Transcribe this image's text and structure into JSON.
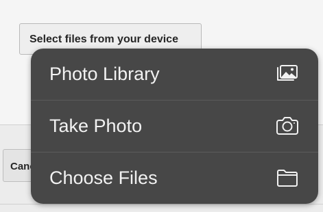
{
  "page": {
    "select_button_label": "Select files from your device",
    "cancel_button_label": "Cancel"
  },
  "menu": {
    "items": [
      {
        "label": "Photo Library",
        "icon": "photo-library-icon"
      },
      {
        "label": "Take Photo",
        "icon": "camera-icon"
      },
      {
        "label": "Choose Files",
        "icon": "folder-icon"
      }
    ]
  },
  "colors": {
    "menu_background": "#474747",
    "menu_text": "#f2f2f2",
    "page_background": "#f4f4f4"
  }
}
